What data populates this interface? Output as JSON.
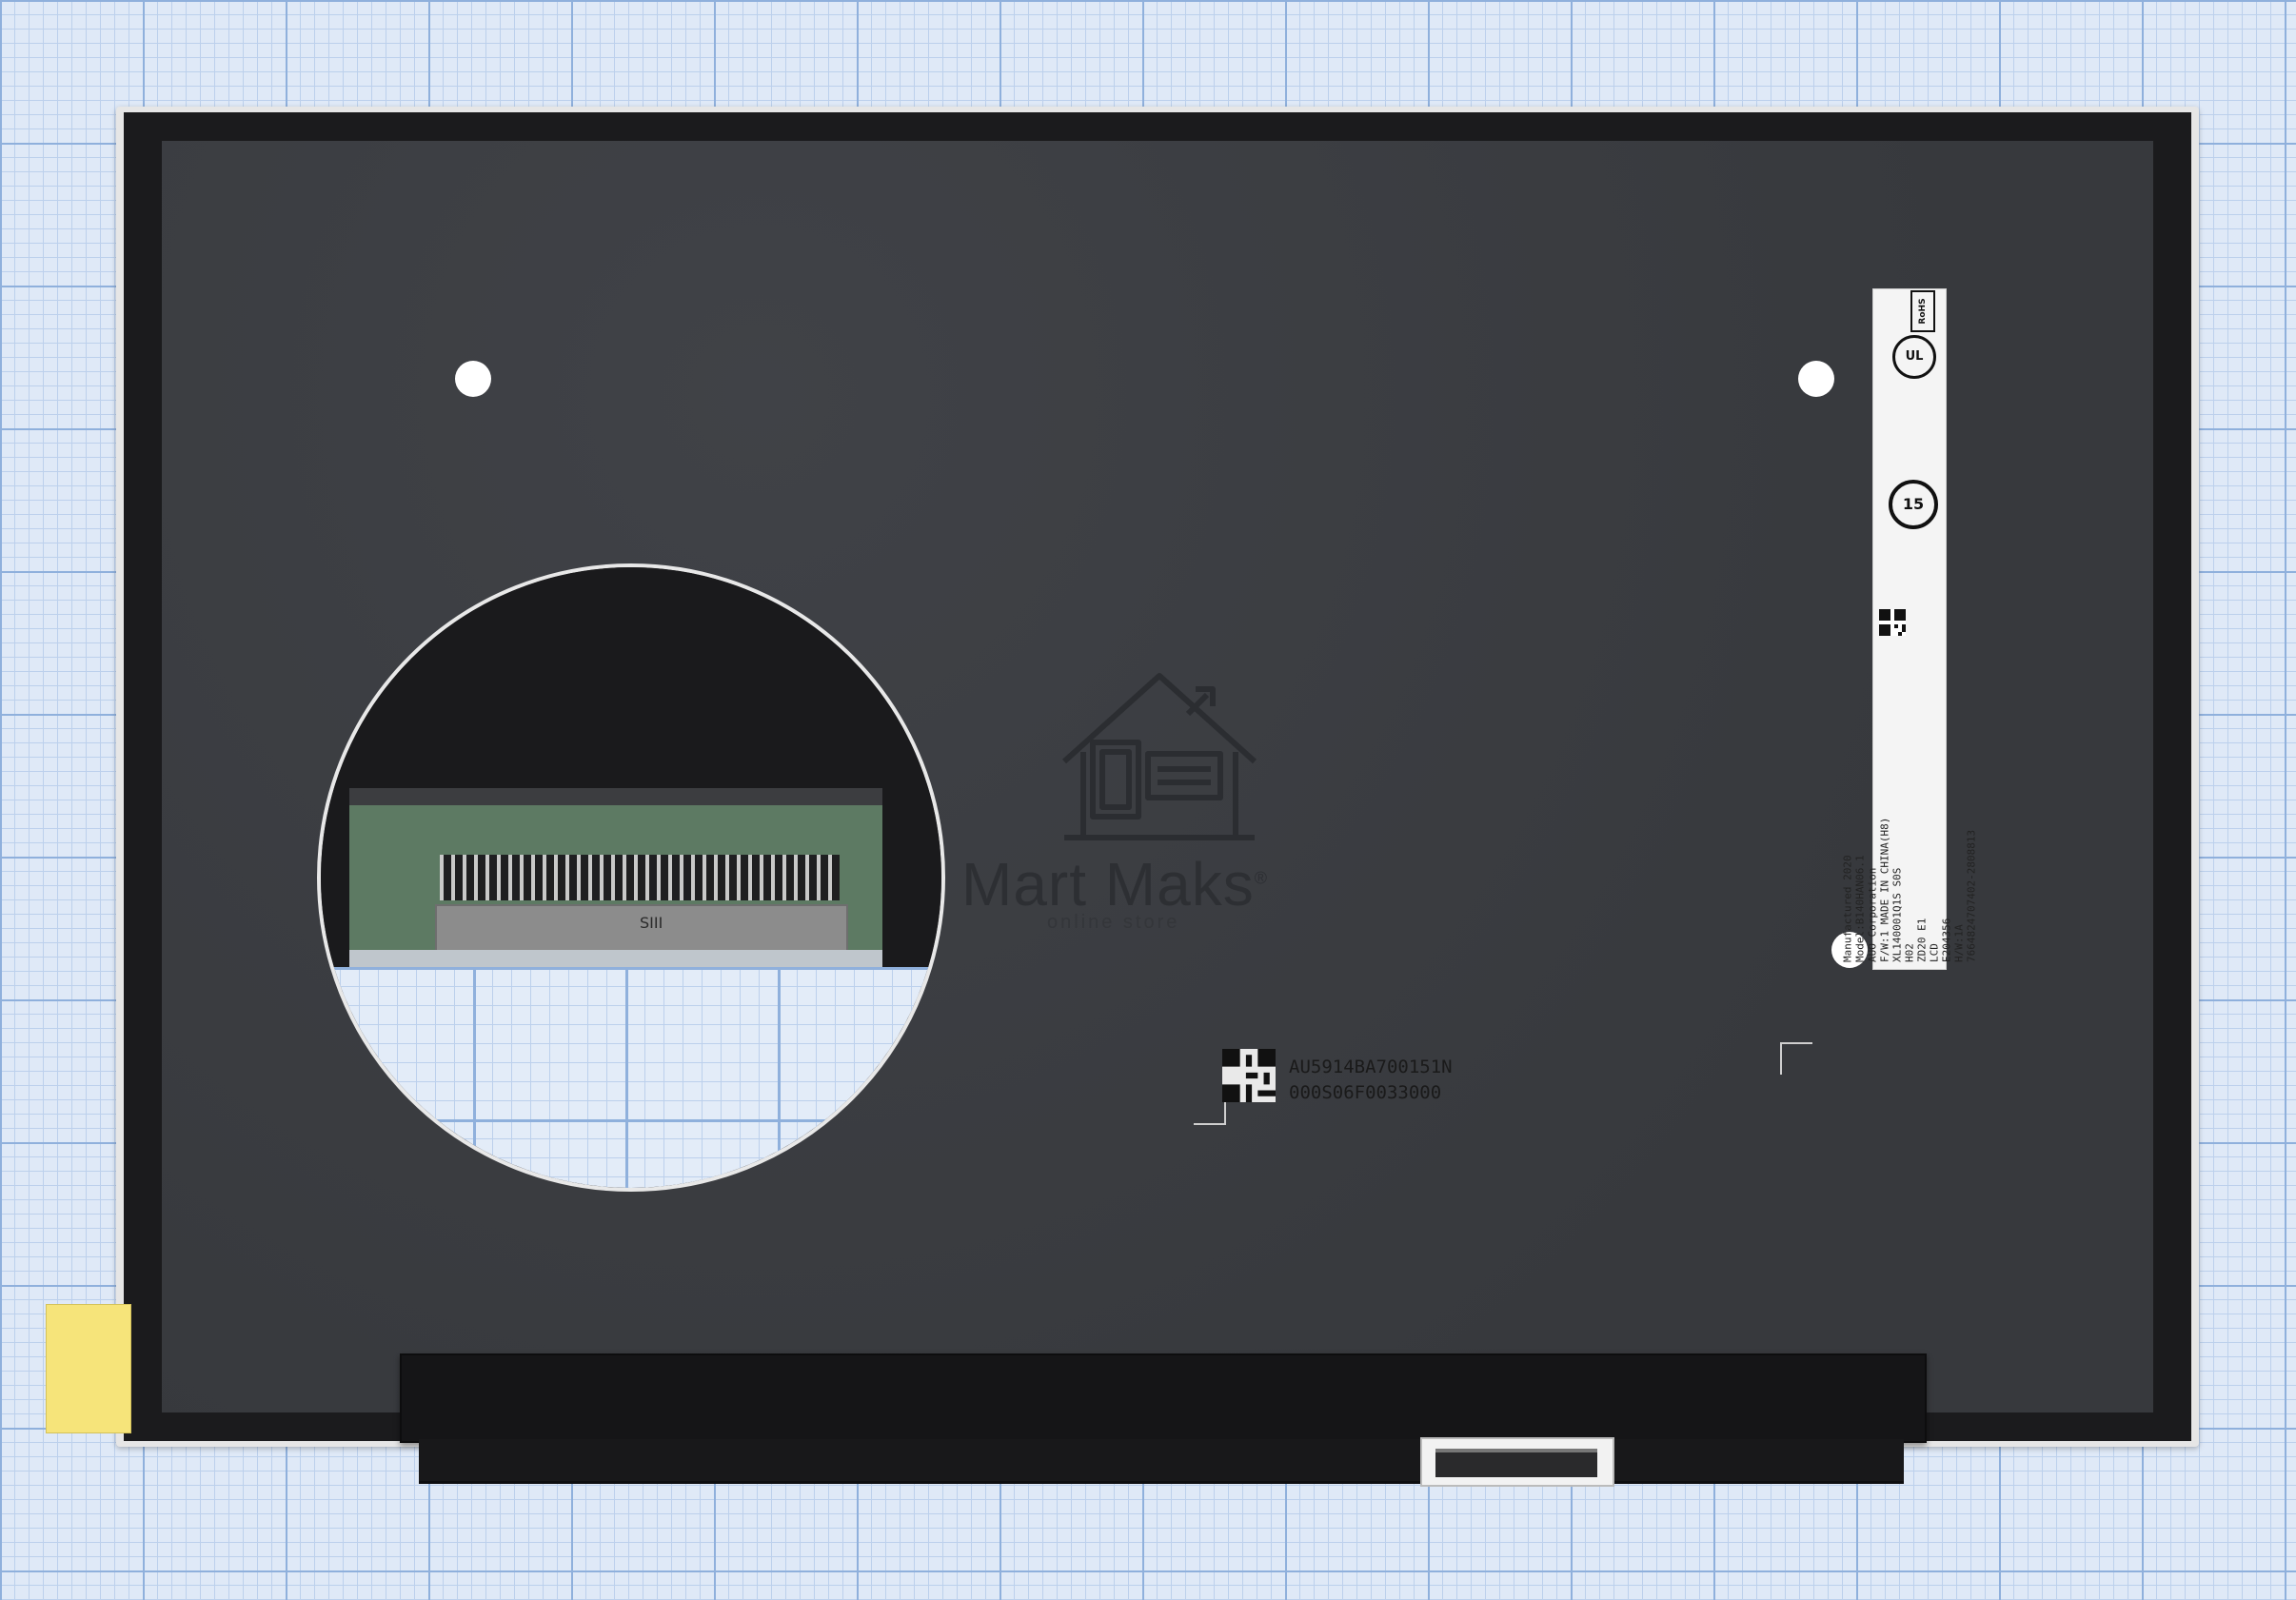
{
  "watermark": {
    "brand": "Mart Maks",
    "sub": "online store",
    "registered": "®"
  },
  "label": {
    "lines": [
      "Manufactured 2020",
      "Model:B140HAN06.1",
      "AUO Corporation",
      "F/W:1  MADE IN CHINA(H8)",
      "XL140001Q1S S0S",
      "H02",
      "ZD20 E1",
      "LCD",
      "E204356",
      "H/W:1A"
    ],
    "barcode_text": "7664824707402-2808813",
    "ul": "UL",
    "rohs": "RoHS",
    "number_mark": "15"
  },
  "serial": {
    "line1": "AU5914BA700151N",
    "line2": "000S06F0033000"
  },
  "connector": {
    "silk": "SIII"
  },
  "colors": {
    "panel_surface": "#3a3c40",
    "grid_line": "#8fb0dc",
    "tape": "#f6e47a"
  }
}
